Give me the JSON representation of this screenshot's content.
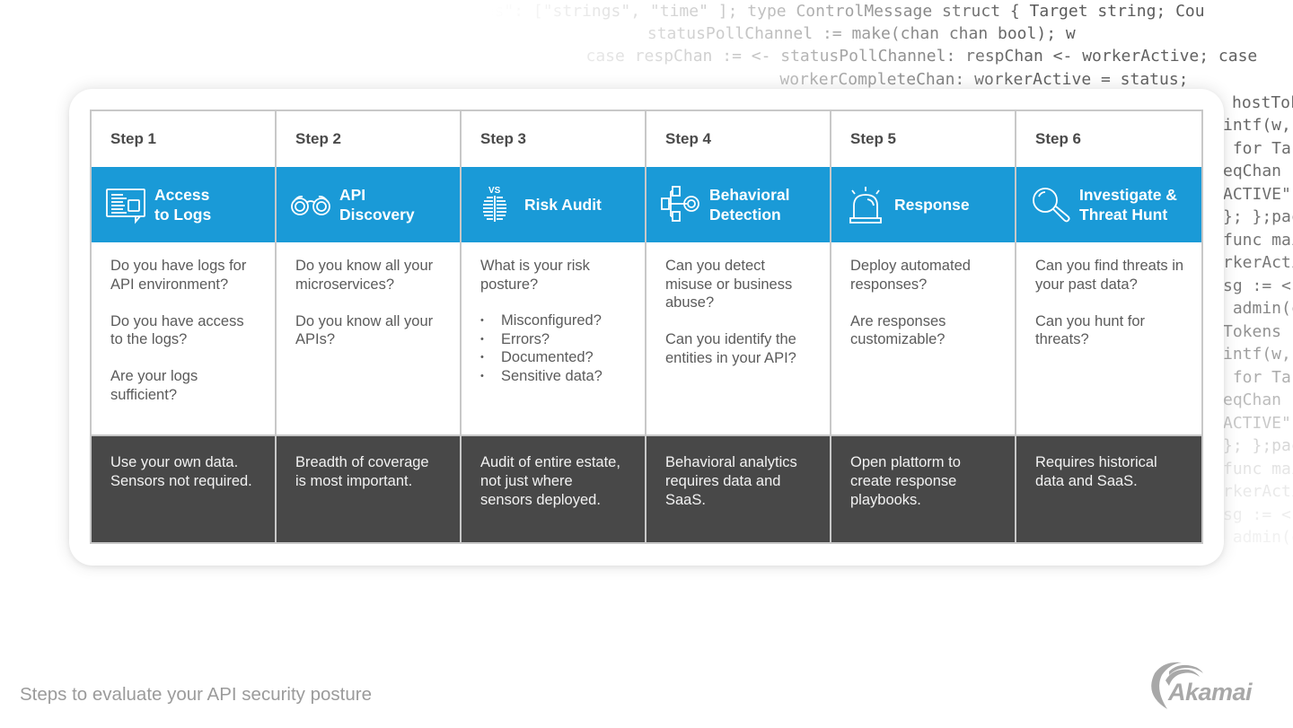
{
  "background_code": [
    "ages\": [\"strings\", \"time\" ]; type ControlMessage struct { Target string; Cou",
    "             statusPollChannel := make(chan chan bool); w",
    "   case respChan := <- statusPollChannel: respChan <- workerActive; case",
    "          workerCompleteChan: workerActive = status;",
    "hostTok",
    "intf(w,",
    " for Tar",
    "eqChan",
    "ACTIVE\"",
    "}; };pac",
    "func mai",
    "rkerActi",
    "sg := <-",
    " admin(c",
    "Tokens",
    "intf(w,",
    " for Tar",
    "eqChan",
    "ACTIVE\"",
    "}; };pac",
    "func mai",
    "rkerActi",
    "sg := <-",
    " admin(c"
  ],
  "steps": [
    {
      "step_label": "Step 1",
      "icon": "log-document-icon",
      "title": "Access\nto Logs",
      "questions": [
        "Do you have logs for API environment?",
        "Do you have access to the logs?",
        "Are your logs sufficient?"
      ],
      "bullets": [],
      "note": "Use your own data. Sensors not required."
    },
    {
      "step_label": "Step 2",
      "icon": "binoculars-icon",
      "title": "API\nDiscovery",
      "questions": [
        "Do you know all your microservices?",
        "Do you know all your APIs?"
      ],
      "bullets": [],
      "note": "Breadth of coverage is most important."
    },
    {
      "step_label": "Step 3",
      "icon": "risk-comparison-icon",
      "icon_label": "VS",
      "title": "Risk Audit",
      "questions": [
        "What is your risk posture?"
      ],
      "bullets": [
        "Misconfigured?",
        "Errors?",
        "Documented?",
        "Sensitive data?"
      ],
      "note": "Audit of entire estate, not just where sensors deployed."
    },
    {
      "step_label": "Step 4",
      "icon": "behavior-flow-target-icon",
      "title": "Behavioral\nDetection",
      "questions": [
        "Can you detect misuse or business abuse?",
        "Can you identify the entities in your API?"
      ],
      "bullets": [],
      "note": "Behavioral analytics requires data and SaaS."
    },
    {
      "step_label": "Step 5",
      "icon": "alarm-siren-icon",
      "title": "Response",
      "questions": [
        "Deploy automated responses?",
        "Are responses customizable?"
      ],
      "bullets": [],
      "note": "Open plattorm to create response playbooks."
    },
    {
      "step_label": "Step 6",
      "icon": "magnifier-icon",
      "title": "Investigate &\nThreat Hunt",
      "questions": [
        "Can you find threats in your past data?",
        "Can you hunt for threats?"
      ],
      "bullets": [],
      "note": "Requires historical data and SaaS."
    }
  ],
  "caption": "Steps to evaluate your API security posture",
  "logo": {
    "text": "Akamai"
  },
  "colors": {
    "header_blue": "#1a9ad7",
    "note_dark": "#484848",
    "grid_border": "#c8c8c8",
    "caption_gray": "#9b9b9b"
  }
}
